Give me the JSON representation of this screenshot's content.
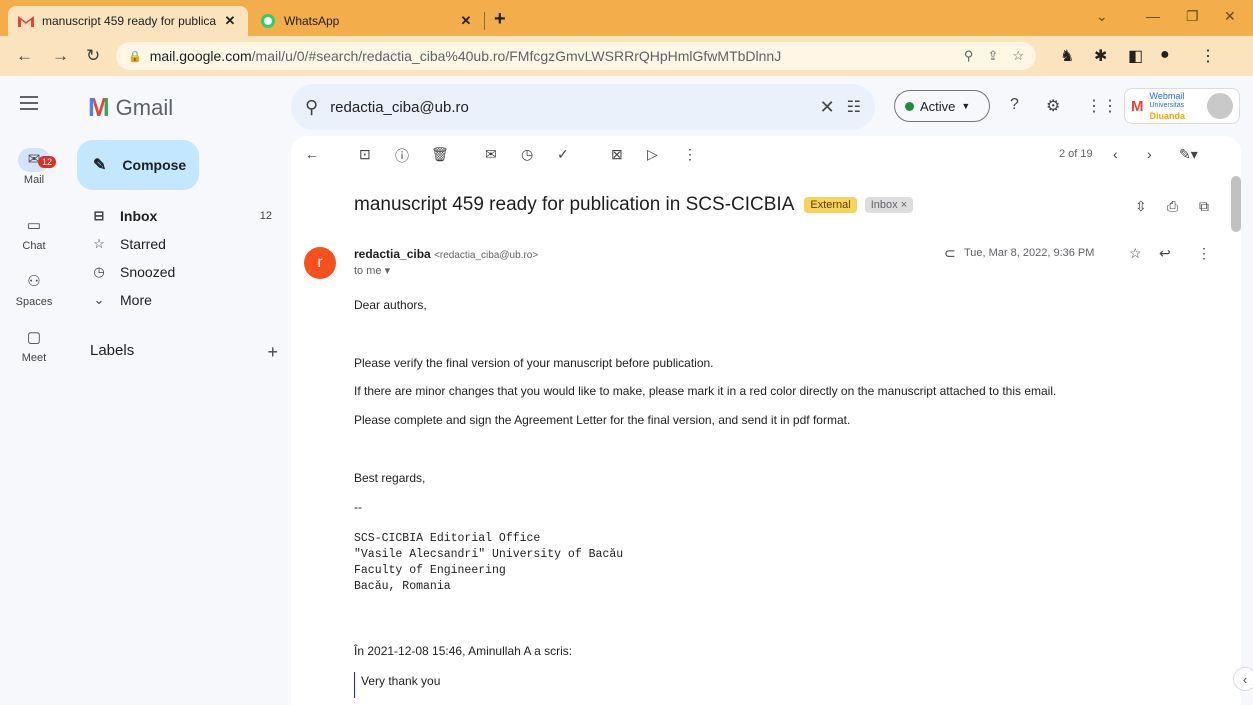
{
  "browser": {
    "tabs": [
      {
        "title": "manuscript 459 ready for publica",
        "icon": "gmail-icon",
        "active": true
      },
      {
        "title": "WhatsApp",
        "icon": "whatsapp-icon",
        "active": false
      }
    ],
    "url_host": "mail.google.com",
    "url_path": "/mail/u/0/#search/redactia_ciba%40ub.ro/FMfcgzGmvLWSRRrQHpHmlGfwMTbDlnnJ",
    "tab_color": "#f3ad4a"
  },
  "gmail": {
    "brand": "Gmail",
    "search_value": "redactia_ciba@ub.ro",
    "status": "Active",
    "account_brand_1": "Webmail",
    "account_brand_2": "Universitas",
    "account_brand_3": "Diuanda"
  },
  "rail": {
    "mail_label": "Mail",
    "mail_badge": "12",
    "chat_label": "Chat",
    "spaces_label": "Spaces",
    "meet_label": "Meet"
  },
  "nav": {
    "compose_label": "Compose",
    "inbox_label": "Inbox",
    "inbox_count": "12",
    "starred_label": "Starred",
    "snoozed_label": "Snoozed",
    "more_label": "More",
    "labels_heading": "Labels"
  },
  "message": {
    "pager": "2 of 19",
    "subject": "manuscript 459 ready for publication in SCS-CICBIA",
    "tag_external": "External",
    "tag_inbox": "Inbox",
    "avatar_letter": "r",
    "sender_name": "redactia_ciba",
    "sender_email": "<redactia_ciba@ub.ro>",
    "to": "to me",
    "date": "Tue, Mar 8, 2022, 9:36 PM",
    "greeting": "Dear authors,",
    "p1": "Please verify the final version of your manuscript before publication.",
    "p2": "If there are minor changes that you would like to make, please mark it in a red color directly on the manuscript attached to this email.",
    "p3": "Please complete and sign the Agreement Letter for the final version, and send it in pdf format.",
    "closing": "Best regards,",
    "dashes": "--",
    "sig1": "SCS-CICBIA Editorial Office",
    "sig2": "\"Vasile Alecsandri\" University of Bacău",
    "sig3": "Faculty of Engineering",
    "sig4": "Bacău, Romania",
    "quote_header": "În 2021-12-08 15:46, Aminullah A a scris:",
    "quote_text": "Very thank you"
  }
}
